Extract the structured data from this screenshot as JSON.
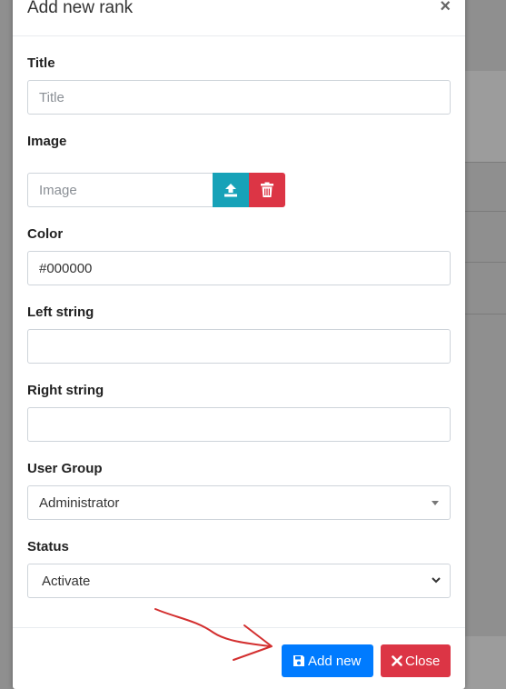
{
  "modal": {
    "title": "Add new rank",
    "close_symbol": "×"
  },
  "fields": {
    "title": {
      "label": "Title",
      "placeholder": "Title",
      "value": ""
    },
    "image": {
      "label": "Image",
      "placeholder": "Image",
      "value": ""
    },
    "color": {
      "label": "Color",
      "value": "#000000"
    },
    "left_string": {
      "label": "Left string",
      "value": ""
    },
    "right_string": {
      "label": "Right string",
      "value": ""
    },
    "user_group": {
      "label": "User Group",
      "selected": "Administrator"
    },
    "status": {
      "label": "Status",
      "selected": "Activate"
    }
  },
  "footer": {
    "add_label": "Add new",
    "close_label": "Close"
  },
  "icons": {
    "upload": "upload-icon",
    "delete": "trash-icon",
    "save": "save-icon",
    "close": "times-icon"
  },
  "colors": {
    "primary": "#007bff",
    "danger": "#dc3545",
    "info": "#17a2b8",
    "annotation": "#d32f2f"
  }
}
